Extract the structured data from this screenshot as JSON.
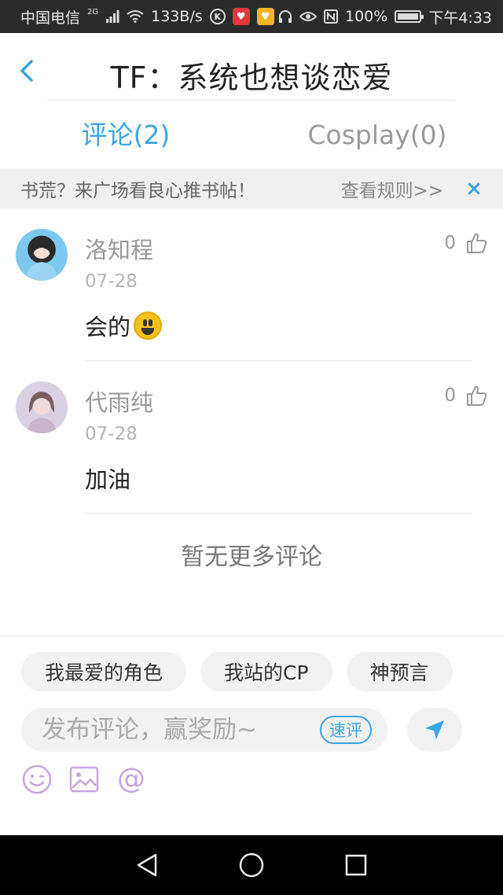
{
  "status_bar": {
    "carrier": "中国电信",
    "network": "2G",
    "speed": "133B/s",
    "battery": "100%",
    "time": "下午4:33",
    "battery_level": 1.0
  },
  "header": {
    "title": "TF：系统也想谈恋爱"
  },
  "tabs": [
    {
      "label": "评论(2)",
      "active": true
    },
    {
      "label": "Cosplay(0)",
      "active": false
    }
  ],
  "banner": {
    "text": "书荒？来广场看良心推书帖！",
    "rules": "查看规则>>",
    "close": "×"
  },
  "comments": [
    {
      "name": "洛知程",
      "date": "07-28",
      "text": "会的",
      "likes": "0"
    },
    {
      "name": "代雨纯",
      "date": "07-28",
      "text": "加油",
      "likes": "0"
    }
  ],
  "no_more": "暂无更多评论",
  "chips": [
    "我最爱的角色",
    "我站的CP",
    "神预言"
  ],
  "composer": {
    "placeholder": "发布评论，赢奖励~",
    "quick": "速评",
    "at": "@"
  },
  "colors": {
    "accent": "#3aa5e3",
    "status_bar": "#2b2b2b",
    "nav_bar": "#000000"
  }
}
